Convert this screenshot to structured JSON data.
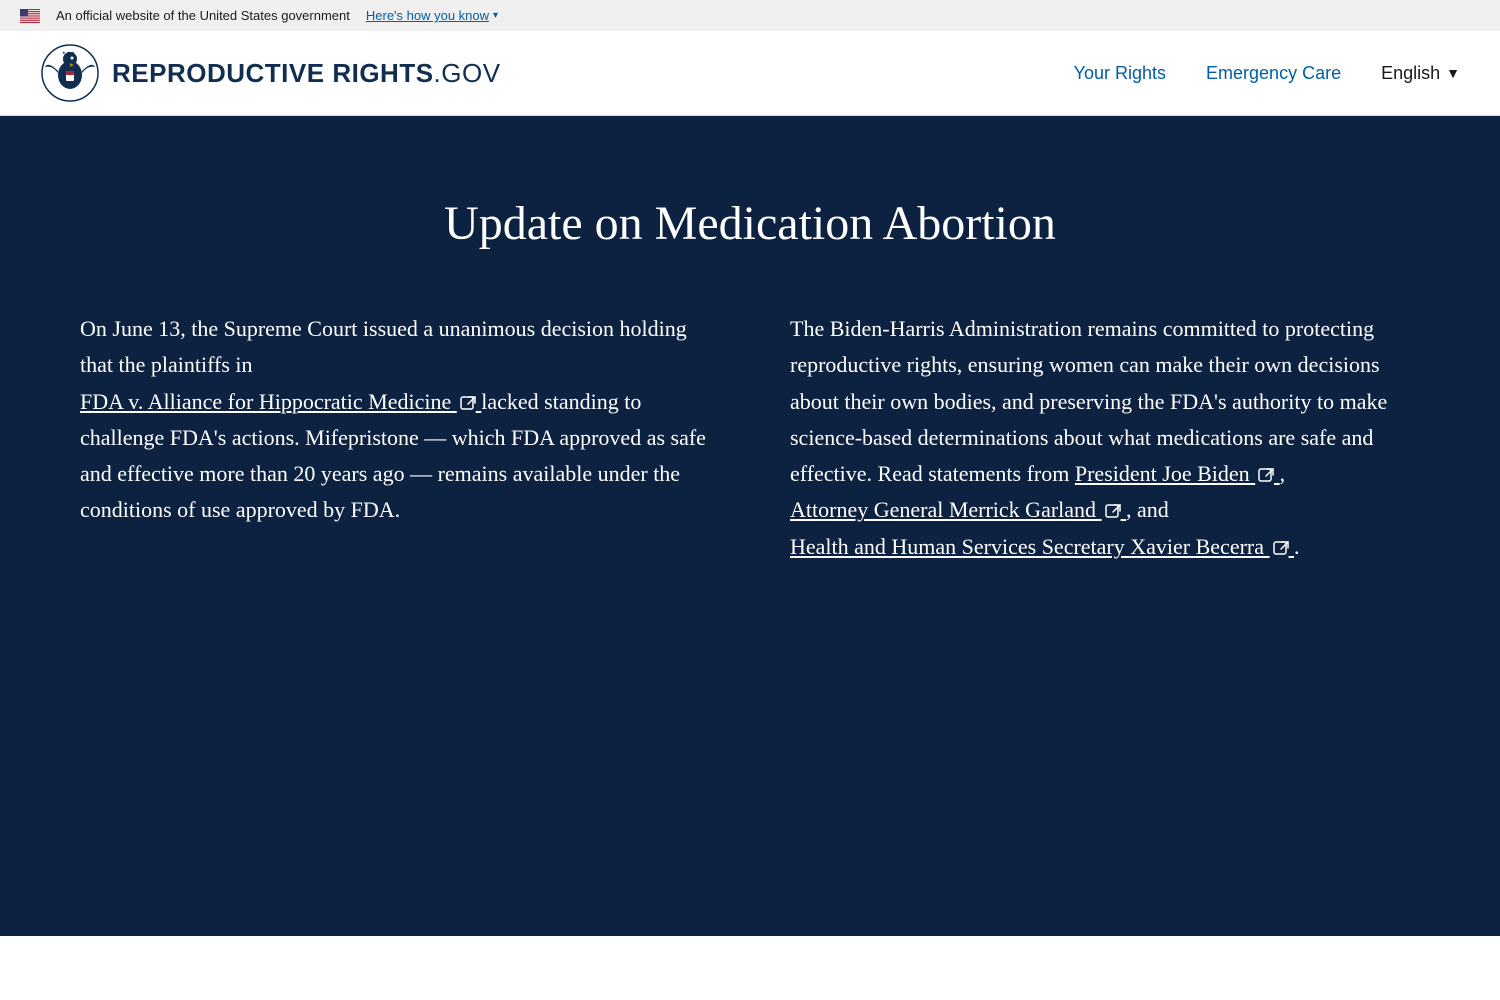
{
  "gov_banner": {
    "official_text": "An official website of the United States government",
    "how_to_know_link": "Here's how you know",
    "chevron": "▾"
  },
  "header": {
    "logo_reproductive": "REPRODUCTIVE",
    "logo_rights": "RIGHTS",
    "logo_gov": ".GOV",
    "nav": {
      "your_rights": "Your Rights",
      "emergency_care": "Emergency Care",
      "language": "English",
      "language_caret": "▼"
    }
  },
  "hero": {
    "title": "Update on Medication Abortion",
    "left_col": {
      "text_before_link": "On June 13, the Supreme Court issued a unanimous decision holding that the plaintiffs in",
      "link_text": "FDA v. Alliance for Hippocratic Medicine",
      "text_after_link": " lacked standing to challenge FDA's actions. Mifepristone — which FDA approved as safe and effective more than 20 years ago — remains available under the conditions of use approved by FDA."
    },
    "right_col": {
      "intro": "The Biden-Harris Administration remains committed to protecting reproductive rights, ensuring women can make their own decisions about their own bodies, and preserving the FDA's authority to make science-based determinations about what medications are safe and effective. Read statements from",
      "link1_text": "President Joe Biden",
      "separator1": ",",
      "link2_text": "Attorney General Merrick Garland",
      "separator2": ", and",
      "link3_text": "Health and Human Services Secretary Xavier Becerra",
      "period": "."
    }
  }
}
